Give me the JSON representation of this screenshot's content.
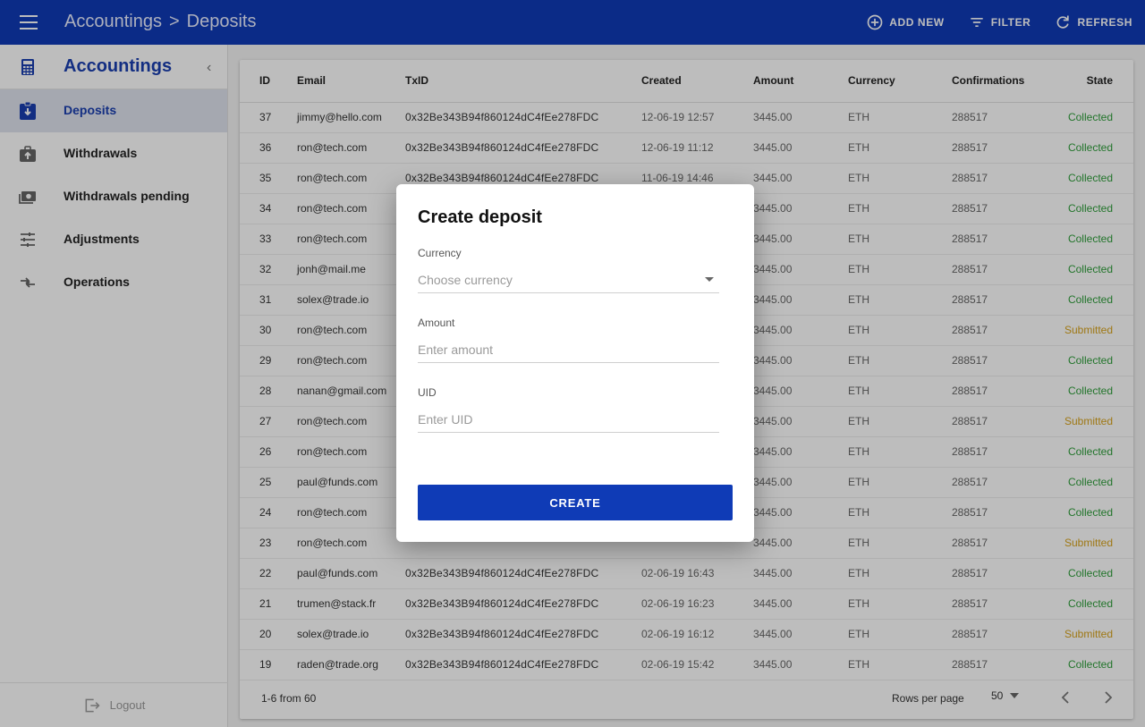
{
  "topbar": {
    "breadcrumb": [
      "Accountings",
      "Deposits"
    ],
    "breadcrumb_sep": ">",
    "actions": [
      {
        "label": "ADD NEW",
        "icon": "add-circle-icon"
      },
      {
        "label": "FILTER",
        "icon": "filter-icon"
      },
      {
        "label": "REFRESH",
        "icon": "refresh-icon"
      }
    ]
  },
  "sidebar": {
    "title": "Accountings",
    "items": [
      {
        "label": "Deposits",
        "icon": "deposit-icon",
        "active": true
      },
      {
        "label": "Withdrawals",
        "icon": "withdrawal-icon",
        "active": false
      },
      {
        "label": "Withdrawals pending",
        "icon": "money-icon",
        "active": false
      },
      {
        "label": "Adjustments",
        "icon": "sliders-icon",
        "active": false
      },
      {
        "label": "Operations",
        "icon": "swap-icon",
        "active": false
      }
    ],
    "logout_label": "Logout"
  },
  "table": {
    "columns": [
      "ID",
      "Email",
      "TxID",
      "Created",
      "Amount",
      "Currency",
      "Confirmations",
      "State"
    ],
    "rows": [
      {
        "id": "37",
        "email": "jimmy@hello.com",
        "txid": "0x32Be343B94f860124dC4fEe278FDC",
        "created": "12-06-19 12:57",
        "amount": "3445.00",
        "currency": "ETH",
        "confirmations": "288517",
        "state": "Collected"
      },
      {
        "id": "36",
        "email": "ron@tech.com",
        "txid": "0x32Be343B94f860124dC4fEe278FDC",
        "created": "12-06-19 11:12",
        "amount": "3445.00",
        "currency": "ETH",
        "confirmations": "288517",
        "state": "Collected"
      },
      {
        "id": "35",
        "email": "ron@tech.com",
        "txid": "0x32Be343B94f860124dC4fEe278FDC",
        "created": "11-06-19 14:46",
        "amount": "3445.00",
        "currency": "ETH",
        "confirmations": "288517",
        "state": "Collected"
      },
      {
        "id": "34",
        "email": "ron@tech.com",
        "txid": "",
        "created": "",
        "amount": "3445.00",
        "currency": "ETH",
        "confirmations": "288517",
        "state": "Collected"
      },
      {
        "id": "33",
        "email": "ron@tech.com",
        "txid": "",
        "created": "",
        "amount": "3445.00",
        "currency": "ETH",
        "confirmations": "288517",
        "state": "Collected"
      },
      {
        "id": "32",
        "email": "jonh@mail.me",
        "txid": "",
        "created": "",
        "amount": "3445.00",
        "currency": "ETH",
        "confirmations": "288517",
        "state": "Collected"
      },
      {
        "id": "31",
        "email": "solex@trade.io",
        "txid": "",
        "created": "",
        "amount": "3445.00",
        "currency": "ETH",
        "confirmations": "288517",
        "state": "Collected"
      },
      {
        "id": "30",
        "email": "ron@tech.com",
        "txid": "",
        "created": "",
        "amount": "3445.00",
        "currency": "ETH",
        "confirmations": "288517",
        "state": "Submitted"
      },
      {
        "id": "29",
        "email": "ron@tech.com",
        "txid": "",
        "created": "",
        "amount": "3445.00",
        "currency": "ETH",
        "confirmations": "288517",
        "state": "Collected"
      },
      {
        "id": "28",
        "email": "nanan@gmail.com",
        "txid": "",
        "created": "",
        "amount": "3445.00",
        "currency": "ETH",
        "confirmations": "288517",
        "state": "Collected"
      },
      {
        "id": "27",
        "email": "ron@tech.com",
        "txid": "",
        "created": "",
        "amount": "3445.00",
        "currency": "ETH",
        "confirmations": "288517",
        "state": "Submitted"
      },
      {
        "id": "26",
        "email": "ron@tech.com",
        "txid": "",
        "created": "",
        "amount": "3445.00",
        "currency": "ETH",
        "confirmations": "288517",
        "state": "Collected"
      },
      {
        "id": "25",
        "email": "paul@funds.com",
        "txid": "",
        "created": "",
        "amount": "3445.00",
        "currency": "ETH",
        "confirmations": "288517",
        "state": "Collected"
      },
      {
        "id": "24",
        "email": "ron@tech.com",
        "txid": "",
        "created": "",
        "amount": "3445.00",
        "currency": "ETH",
        "confirmations": "288517",
        "state": "Collected"
      },
      {
        "id": "23",
        "email": "ron@tech.com",
        "txid": "",
        "created": "",
        "amount": "3445.00",
        "currency": "ETH",
        "confirmations": "288517",
        "state": "Submitted"
      },
      {
        "id": "22",
        "email": "paul@funds.com",
        "txid": "0x32Be343B94f860124dC4fEe278FDC",
        "created": "02-06-19 16:43",
        "amount": "3445.00",
        "currency": "ETH",
        "confirmations": "288517",
        "state": "Collected"
      },
      {
        "id": "21",
        "email": "trumen@stack.fr",
        "txid": "0x32Be343B94f860124dC4fEe278FDC",
        "created": "02-06-19 16:23",
        "amount": "3445.00",
        "currency": "ETH",
        "confirmations": "288517",
        "state": "Collected"
      },
      {
        "id": "20",
        "email": "solex@trade.io",
        "txid": "0x32Be343B94f860124dC4fEe278FDC",
        "created": "02-06-19 16:12",
        "amount": "3445.00",
        "currency": "ETH",
        "confirmations": "288517",
        "state": "Submitted"
      },
      {
        "id": "19",
        "email": "raden@trade.org",
        "txid": "0x32Be343B94f860124dC4fEe278FDC",
        "created": "02-06-19 15:42",
        "amount": "3445.00",
        "currency": "ETH",
        "confirmations": "288517",
        "state": "Collected"
      }
    ]
  },
  "pager": {
    "range": "1-6 from 60",
    "rows_per_page_label": "Rows per page",
    "rows_per_page_value": "50"
  },
  "dialog": {
    "title": "Create deposit",
    "fields": [
      {
        "label": "Currency",
        "placeholder": "Choose currency",
        "type": "select"
      },
      {
        "label": "Amount",
        "placeholder": "Enter amount",
        "type": "input"
      },
      {
        "label": "UID",
        "placeholder": "Enter UID",
        "type": "input"
      }
    ],
    "submit_label": "CREATE"
  },
  "colors": {
    "primary": "#0f3bb6",
    "collected": "#2e9e3a",
    "submitted": "#d7a21c"
  }
}
